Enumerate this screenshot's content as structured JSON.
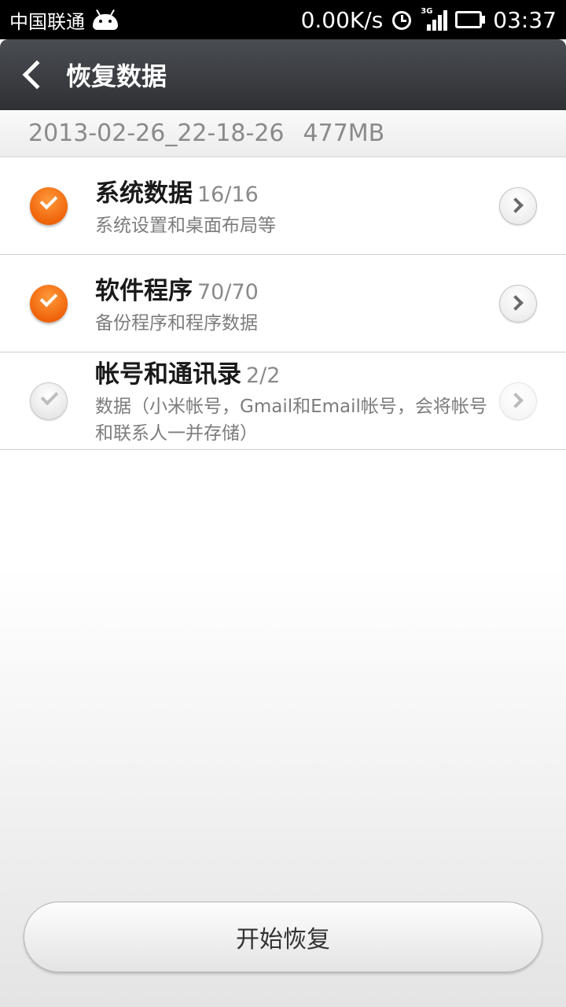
{
  "status_bar": {
    "carrier": "中国联通",
    "network_speed": "0.00K/s",
    "network_type": "3G",
    "time": "03:37"
  },
  "header": {
    "title": "恢复数据"
  },
  "backup_info": {
    "date": "2013-02-26_22-18-26",
    "size": "477MB"
  },
  "items": [
    {
      "title": "系统数据",
      "count": "16/16",
      "description": "系统设置和桌面布局等",
      "checked": true
    },
    {
      "title": "软件程序",
      "count": "70/70",
      "description": "备份程序和程序数据",
      "checked": true
    },
    {
      "title": "帐号和通讯录",
      "count": "2/2",
      "description": "数据（小米帐号，Gmail和Email帐号，会将帐号和联系人一并存储）",
      "checked": false
    }
  ],
  "footer": {
    "start_label": "开始恢复"
  },
  "colors": {
    "accent_orange": "#f0640a",
    "title_bar": "#3a3c40"
  }
}
